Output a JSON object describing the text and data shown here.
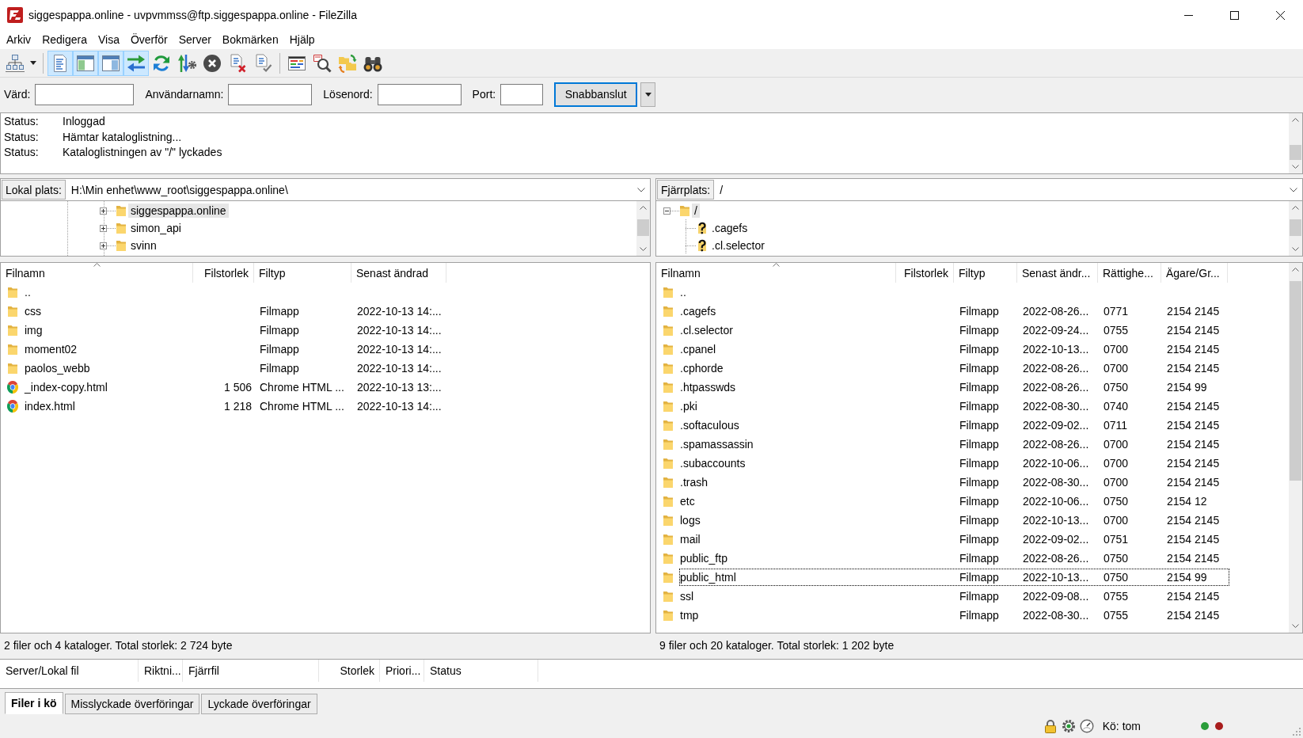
{
  "window": {
    "title": "siggespappa.online - uvpvmmss@ftp.siggespappa.online - FileZilla"
  },
  "menu": [
    "Arkiv",
    "Redigera",
    "Visa",
    "Överför",
    "Server",
    "Bokmärken",
    "Hjälp"
  ],
  "toolbar": {
    "groups": [
      [
        {
          "kind": "site-manager",
          "pressed": false
        }
      ],
      [
        {
          "kind": "message-log",
          "pressed": true
        },
        {
          "kind": "local-tree",
          "pressed": true
        },
        {
          "kind": "remote-tree",
          "pressed": true
        },
        {
          "kind": "transfer-queue",
          "pressed": true
        },
        {
          "kind": "refresh",
          "pressed": false
        },
        {
          "kind": "process-queue",
          "pressed": false
        },
        {
          "kind": "cancel",
          "pressed": false
        },
        {
          "kind": "disconnect",
          "pressed": false
        },
        {
          "kind": "reconnect",
          "pressed": false
        }
      ],
      [
        {
          "kind": "filter",
          "pressed": false
        },
        {
          "kind": "compare",
          "pressed": false
        },
        {
          "kind": "sync-browsing",
          "pressed": false
        },
        {
          "kind": "search",
          "pressed": false
        }
      ]
    ]
  },
  "quickconnect": {
    "fields": [
      {
        "label": "Värd:"
      },
      {
        "label": "Användarnamn:"
      },
      {
        "label": "Lösenord:"
      },
      {
        "label": "Port:"
      }
    ],
    "button": "Snabbanslut"
  },
  "message_log": [
    {
      "label": "Status:",
      "text": "Inloggad"
    },
    {
      "label": "Status:",
      "text": "Hämtar kataloglistning..."
    },
    {
      "label": "Status:",
      "text": "Kataloglistningen av \"/\" lyckades"
    }
  ],
  "local": {
    "path_label": "Lokal plats:",
    "path": "H:\\Min enhet\\www_root\\siggespappa.online\\",
    "tree": [
      {
        "name": "siggespappa.online",
        "kind": "folder",
        "expanded": false,
        "selected": true
      },
      {
        "name": "simon_api",
        "kind": "folder",
        "expanded": false,
        "selected": false
      },
      {
        "name": "svinn",
        "kind": "folder",
        "expanded": false,
        "selected": false
      }
    ],
    "columns": [
      {
        "label": "Filnamn",
        "sorted": true
      },
      {
        "label": "Filstorlek",
        "sorted": false
      },
      {
        "label": "Filtyp",
        "sorted": false
      },
      {
        "label": "Senast ändrad",
        "sorted": false
      }
    ],
    "rows": [
      {
        "kind": "folder",
        "name": ".."
      },
      {
        "kind": "folder",
        "name": "css",
        "type": "Filmapp",
        "modified": "2022-10-13 14:..."
      },
      {
        "kind": "folder",
        "name": "img",
        "type": "Filmapp",
        "modified": "2022-10-13 14:..."
      },
      {
        "kind": "folder",
        "name": "moment02",
        "type": "Filmapp",
        "modified": "2022-10-13 14:..."
      },
      {
        "kind": "folder",
        "name": "paolos_webb",
        "type": "Filmapp",
        "modified": "2022-10-13 14:..."
      },
      {
        "kind": "file",
        "name": "_index-copy.html",
        "size": "1 506",
        "type": "Chrome HTML ...",
        "modified": "2022-10-13 13:..."
      },
      {
        "kind": "file",
        "name": "index.html",
        "size": "1 218",
        "type": "Chrome HTML ...",
        "modified": "2022-10-13 14:..."
      }
    ],
    "status": "2 filer och 4 kataloger. Total storlek: 2 724 byte"
  },
  "remote": {
    "path_label": "Fjärrplats:",
    "path": "/",
    "tree": [
      {
        "name": "/",
        "kind": "folder",
        "expanded": true,
        "selected": true,
        "children": [
          {
            "name": ".cagefs",
            "kind": "unknown",
            "selected": false
          },
          {
            "name": ".cl.selector",
            "kind": "unknown",
            "selected": false
          }
        ]
      }
    ],
    "columns": [
      {
        "label": "Filnamn",
        "sorted": true
      },
      {
        "label": "Filstorlek",
        "sorted": false
      },
      {
        "label": "Filtyp",
        "sorted": false
      },
      {
        "label": "Senast ändr...",
        "sorted": false
      },
      {
        "label": "Rättighe...",
        "sorted": false
      },
      {
        "label": "Ägare/Gr...",
        "sorted": false
      }
    ],
    "rows": [
      {
        "kind": "folder",
        "name": "..",
        "focused": false
      },
      {
        "kind": "folder",
        "name": ".cagefs",
        "type": "Filmapp",
        "modified": "2022-08-26...",
        "permissions": "0771",
        "owner": "2154 2145",
        "focused": false
      },
      {
        "kind": "folder",
        "name": ".cl.selector",
        "type": "Filmapp",
        "modified": "2022-09-24...",
        "permissions": "0755",
        "owner": "2154 2145",
        "focused": false
      },
      {
        "kind": "folder",
        "name": ".cpanel",
        "type": "Filmapp",
        "modified": "2022-10-13...",
        "permissions": "0700",
        "owner": "2154 2145",
        "focused": false
      },
      {
        "kind": "folder",
        "name": ".cphorde",
        "type": "Filmapp",
        "modified": "2022-08-26...",
        "permissions": "0700",
        "owner": "2154 2145",
        "focused": false
      },
      {
        "kind": "folder",
        "name": ".htpasswds",
        "type": "Filmapp",
        "modified": "2022-08-26...",
        "permissions": "0750",
        "owner": "2154 99",
        "focused": false
      },
      {
        "kind": "folder",
        "name": ".pki",
        "type": "Filmapp",
        "modified": "2022-08-30...",
        "permissions": "0740",
        "owner": "2154 2145",
        "focused": false
      },
      {
        "kind": "folder",
        "name": ".softaculous",
        "type": "Filmapp",
        "modified": "2022-09-02...",
        "permissions": "0711",
        "owner": "2154 2145",
        "focused": false
      },
      {
        "kind": "folder",
        "name": ".spamassassin",
        "type": "Filmapp",
        "modified": "2022-08-26...",
        "permissions": "0700",
        "owner": "2154 2145",
        "focused": false
      },
      {
        "kind": "folder",
        "name": ".subaccounts",
        "type": "Filmapp",
        "modified": "2022-10-06...",
        "permissions": "0700",
        "owner": "2154 2145",
        "focused": false
      },
      {
        "kind": "folder",
        "name": ".trash",
        "type": "Filmapp",
        "modified": "2022-08-30...",
        "permissions": "0700",
        "owner": "2154 2145",
        "focused": false
      },
      {
        "kind": "folder",
        "name": "etc",
        "type": "Filmapp",
        "modified": "2022-10-06...",
        "permissions": "0750",
        "owner": "2154 12",
        "focused": false
      },
      {
        "kind": "folder",
        "name": "logs",
        "type": "Filmapp",
        "modified": "2022-10-13...",
        "permissions": "0700",
        "owner": "2154 2145",
        "focused": false
      },
      {
        "kind": "folder",
        "name": "mail",
        "type": "Filmapp",
        "modified": "2022-09-02...",
        "permissions": "0751",
        "owner": "2154 2145",
        "focused": false
      },
      {
        "kind": "folder",
        "name": "public_ftp",
        "type": "Filmapp",
        "modified": "2022-08-26...",
        "permissions": "0750",
        "owner": "2154 2145",
        "focused": false
      },
      {
        "kind": "folder",
        "name": "public_html",
        "type": "Filmapp",
        "modified": "2022-10-13...",
        "permissions": "0750",
        "owner": "2154 99",
        "focused": true
      },
      {
        "kind": "folder",
        "name": "ssl",
        "type": "Filmapp",
        "modified": "2022-09-08...",
        "permissions": "0755",
        "owner": "2154 2145",
        "focused": false
      },
      {
        "kind": "folder",
        "name": "tmp",
        "type": "Filmapp",
        "modified": "2022-08-30...",
        "permissions": "0755",
        "owner": "2154 2145",
        "focused": false
      }
    ],
    "status": "9 filer och 20 kataloger. Total storlek: 1 202 byte"
  },
  "queue": {
    "columns": [
      "Server/Lokal fil",
      "Riktni...",
      "Fjärrfil",
      "Storlek",
      "Priori...",
      "Status"
    ]
  },
  "tabs": [
    {
      "label": "Filer i kö",
      "selected": true
    },
    {
      "label": "Misslyckade överföringar",
      "selected": false
    },
    {
      "label": "Lyckade överföringar",
      "selected": false
    }
  ],
  "status_bar": {
    "queue": "Kö: tom",
    "lights": [
      {
        "color": "#2a9d3a"
      },
      {
        "color": "#a81c1c"
      }
    ]
  }
}
